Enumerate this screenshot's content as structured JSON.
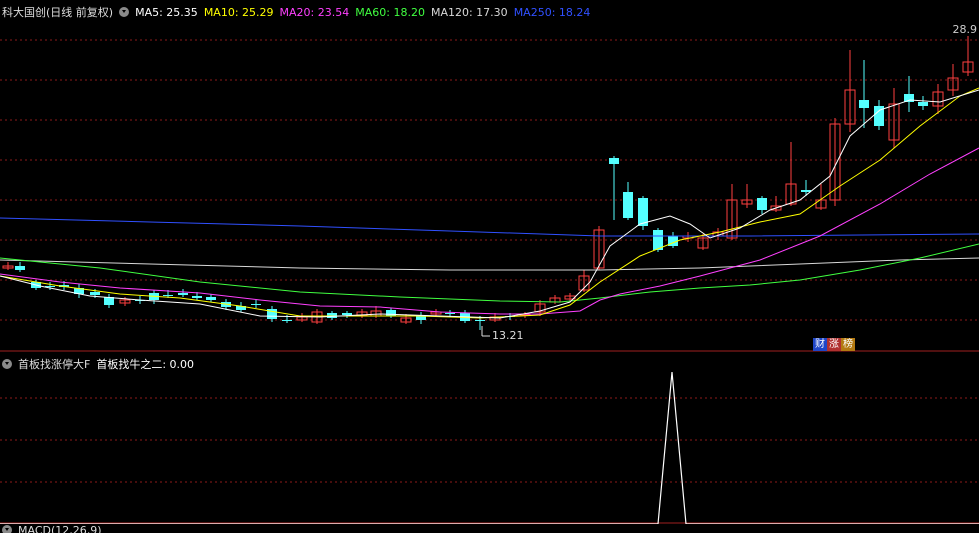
{
  "main": {
    "title": "科大国创(日线 前复权)",
    "ma": [
      {
        "label": "MA5: 25.35",
        "color": "#ffffff"
      },
      {
        "label": "MA10: 25.29",
        "color": "#ffff00"
      },
      {
        "label": "MA20: 23.54",
        "color": "#ff40ff"
      },
      {
        "label": "MA60: 18.20",
        "color": "#40ff40"
      },
      {
        "label": "MA120: 17.30",
        "color": "#d8d8d8"
      },
      {
        "label": "MA250: 18.24",
        "color": "#3050ff"
      }
    ],
    "top_price_label": "28.9",
    "low_price_label": "13.21",
    "badges": [
      "财",
      "涨",
      "榜"
    ],
    "colors": {
      "up": "#ff4040",
      "down": "#54ffff",
      "grid": "#8b1a1a"
    }
  },
  "sub": {
    "title": "首板找涨停大F",
    "indicator": "首板找牛之二: 0.00",
    "indicator_color": "#ffffff"
  },
  "bottom": {
    "title": "MACD(12,26,9)"
  }
}
